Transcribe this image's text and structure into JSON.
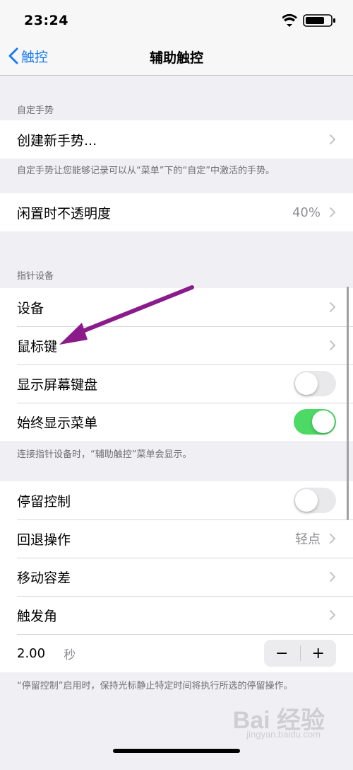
{
  "status": {
    "time": "23:24"
  },
  "nav": {
    "back_label": "触控",
    "title": "辅助触控"
  },
  "custom": {
    "header": "自定手势",
    "create_label": "创建新手势...",
    "footer": "自定手势让您能够记录可以从“菜单”下的“自定”中激活的手势。"
  },
  "idle": {
    "label": "闲置时不透明度",
    "value": "40%"
  },
  "pointer": {
    "header": "指针设备",
    "devices_label": "设备",
    "mouse_keys_label": "鼠标键",
    "show_keyboard_label": "显示屏幕键盘",
    "show_keyboard_on": false,
    "always_menu_label": "始终显示菜单",
    "always_menu_on": true,
    "footer": "连接指针设备时，“辅助触控”菜单会显示。"
  },
  "dwell": {
    "control_label": "停留控制",
    "control_on": false,
    "fallback_label": "回退操作",
    "fallback_value": "轻点",
    "tolerance_label": "移动容差",
    "hot_corners_label": "触发角",
    "time_value": "2.00",
    "time_unit": "秒",
    "minus": "−",
    "plus": "+",
    "footer": "“停留控制”启用时，保持光标静止特定时间将执行所选的停留操作。"
  },
  "watermark": {
    "brand": "Bai  经验",
    "sub": "jingyan.baidu.com"
  },
  "colors": {
    "accent": "#1a7cf0",
    "toggle_on": "#4cd964",
    "arrow": "#8b1a8b"
  }
}
